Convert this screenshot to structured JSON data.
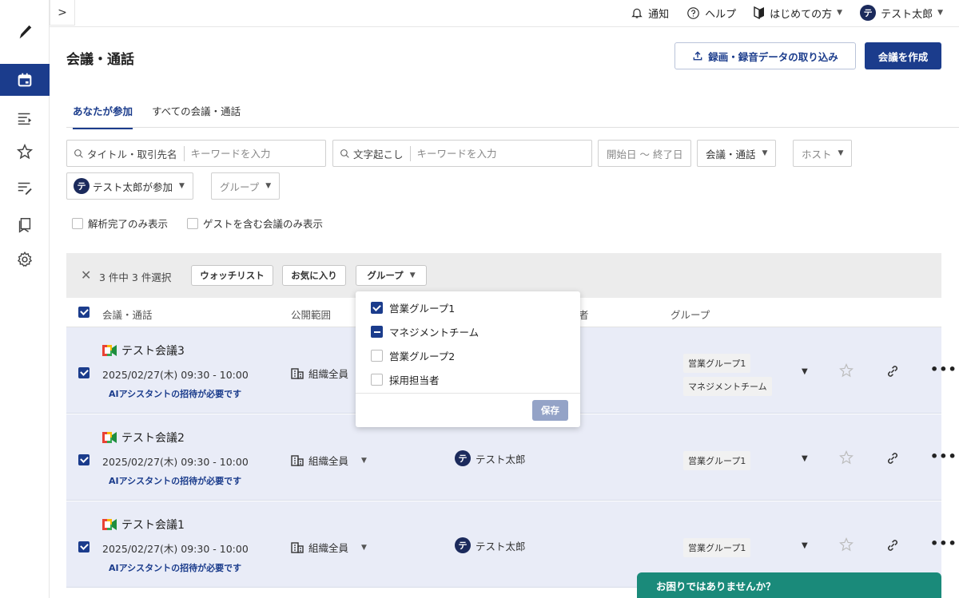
{
  "topnav": {
    "notifications": "通知",
    "help": "ヘルプ",
    "getting_started": "はじめての方",
    "user_initial": "テ",
    "user_name": "テスト太郎"
  },
  "header": {
    "title": "会議・通話",
    "import_label": "録画・録音データの取り込み",
    "create_label": "会議を作成"
  },
  "tabs": [
    {
      "label": "あなたが参加",
      "active": true
    },
    {
      "label": "すべての会議・通話",
      "active": false
    }
  ],
  "filters": {
    "title_search": {
      "prefix": "タイトル・取引先名",
      "placeholder": "キーワードを入力"
    },
    "transcript_search": {
      "prefix": "文字起こし",
      "placeholder": "キーワードを入力"
    },
    "date_range": "開始日 〜 終了日",
    "type": "会議・通話",
    "host": "ホスト",
    "participant": "テスト太郎が参加",
    "group": "グループ",
    "only_analyzed": "解析完了のみ表示",
    "only_guests": "ゲストを含む会議のみ表示"
  },
  "selection": {
    "count_text": "3 件中 3 件選択",
    "watchlist": "ウォッチリスト",
    "favorite": "お気に入り",
    "group": "グループ"
  },
  "columns": {
    "meeting": "会議・通話",
    "scope": "公開範囲",
    "host_partial": "者",
    "group": "グループ"
  },
  "rows": [
    {
      "title": "テスト会議3",
      "datetime": "2025/02/27(木) 09:30 - 10:00",
      "ai_notice": "AIアシスタントの招待が必要です",
      "scope": "組織全員",
      "host": "",
      "groups": [
        "営業グループ1",
        "マネジメントチーム"
      ]
    },
    {
      "title": "テスト会議2",
      "datetime": "2025/02/27(木) 09:30 - 10:00",
      "ai_notice": "AIアシスタントの招待が必要です",
      "scope": "組織全員",
      "host": "テスト太郎",
      "groups": [
        "営業グループ1"
      ]
    },
    {
      "title": "テスト会議1",
      "datetime": "2025/02/27(木) 09:30 - 10:00",
      "ai_notice": "AIアシスタントの招待が必要です",
      "scope": "組織全員",
      "host": "テスト太郎",
      "groups": [
        "営業グループ1"
      ]
    }
  ],
  "group_popover": {
    "options": [
      {
        "label": "営業グループ1",
        "state": "checked"
      },
      {
        "label": "マネジメントチーム",
        "state": "partial"
      },
      {
        "label": "営業グループ2",
        "state": "unchecked"
      },
      {
        "label": "採用担当者",
        "state": "unchecked"
      }
    ],
    "save_label": "保存"
  },
  "help_chat": "お困りではありませんか？",
  "colors": {
    "primary": "#1b3c8c",
    "row_selected": "#e9ecf7",
    "help": "#1a8a7a"
  }
}
